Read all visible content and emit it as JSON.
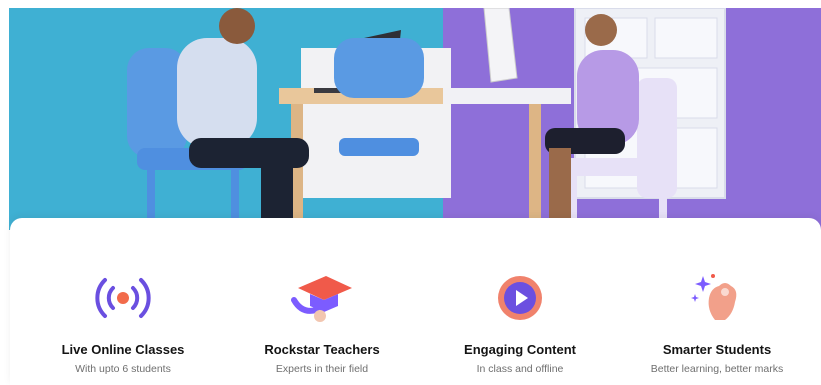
{
  "hero": {
    "left_bg_color": "#3fb0d3",
    "right_bg_color": "#8e6fd9",
    "accent_chair_color": "#5a9ae3",
    "desk_color": "#e9c79b"
  },
  "features": [
    {
      "icon": "live-broadcast-icon",
      "title": "Live Online Classes",
      "subtitle": "With upto 6 students"
    },
    {
      "icon": "graduation-cap-icon",
      "title": "Rockstar Teachers",
      "subtitle": "Experts in their field"
    },
    {
      "icon": "play-button-icon",
      "title": "Engaging Content",
      "subtitle": "In class and offline"
    },
    {
      "icon": "sparkle-hand-icon",
      "title": "Smarter Students",
      "subtitle": "Better learning, better marks"
    }
  ],
  "colors": {
    "broadcast_purple": "#6a4fe0",
    "broadcast_dot": "#f26b4b",
    "cap_red": "#f05a4a",
    "cap_purple": "#7c5cff",
    "play_ring": "#f0826c",
    "play_center": "#6b4fe0",
    "hand_peach": "#f2a08a"
  }
}
